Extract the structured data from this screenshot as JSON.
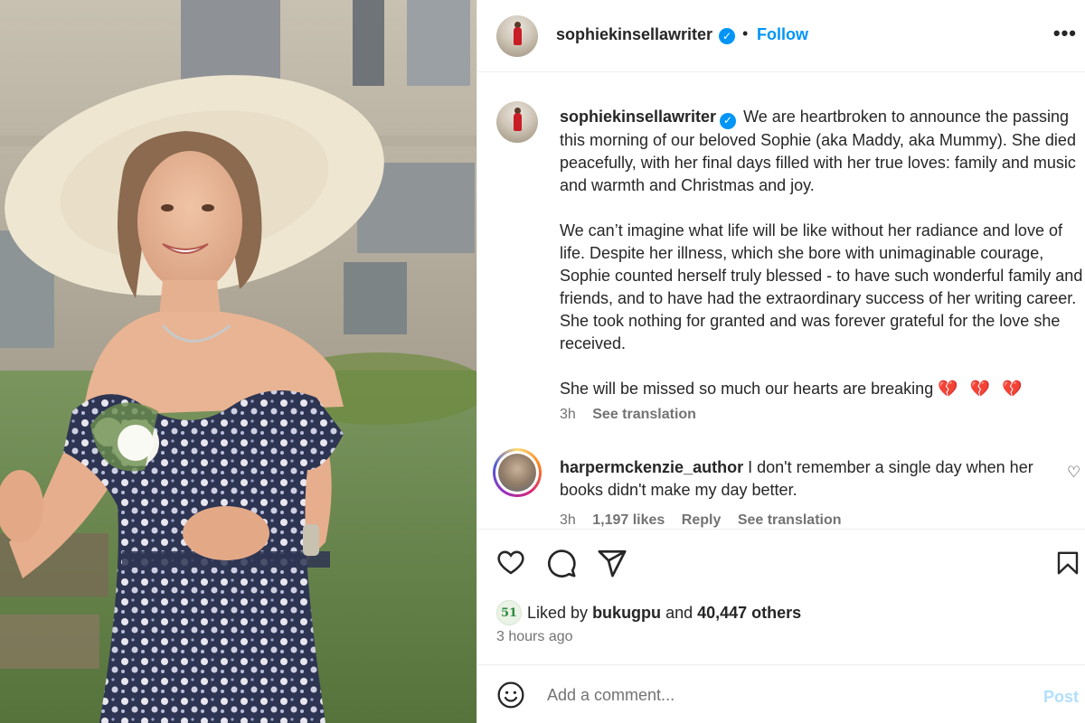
{
  "post": {
    "username": "sophiekinsellawriter",
    "follow_label": "Follow",
    "dot": "•",
    "more_label": "•••",
    "verified_mark": "✓"
  },
  "caption": {
    "username": "sophiekinsellawriter",
    "paragraph1": "We are heartbroken to announce the passing this morning of our beloved Sophie (aka Maddy, aka Mummy). She died peacefully, with her final days filled with her true loves: family and music and warmth and Christmas and joy.",
    "paragraph2": "We can’t imagine what life will be like without her radiance and love of life. Despite her illness, which she bore with unimaginable courage, Sophie counted herself truly blessed - to have such wonderful family and friends, and to have had the extraordinary success of her writing career. She took nothing for granted and was forever grateful for the love she received.",
    "paragraph3": "She will be missed so much our hearts are breaking",
    "hearts": "💔 💔 💔",
    "time": "3h",
    "see_translation": "See translation"
  },
  "comment": {
    "username": "harpermckenzie_author",
    "text": "I don't remember a single day when her books didn't make my day better.",
    "time": "3h",
    "likes": "1,197 likes",
    "reply": "Reply",
    "see_translation": "See translation",
    "like_icon": "♡"
  },
  "icons": {
    "like": "heart-icon",
    "comment": "comment-icon",
    "share": "share-icon",
    "save": "bookmark-icon",
    "emoji": "emoji-icon"
  },
  "likes": {
    "avatar_text": "51",
    "prefix": "Liked by",
    "liker": "bukugpu",
    "connector": "and",
    "others": "40,447 others",
    "time_ago": "3 hours ago"
  },
  "composer": {
    "placeholder": "Add a comment...",
    "post_label": "Post"
  },
  "colors": {
    "link_blue": "#0095f6",
    "post_disabled": "#b2dffc",
    "heart_red": "#e0245e"
  }
}
